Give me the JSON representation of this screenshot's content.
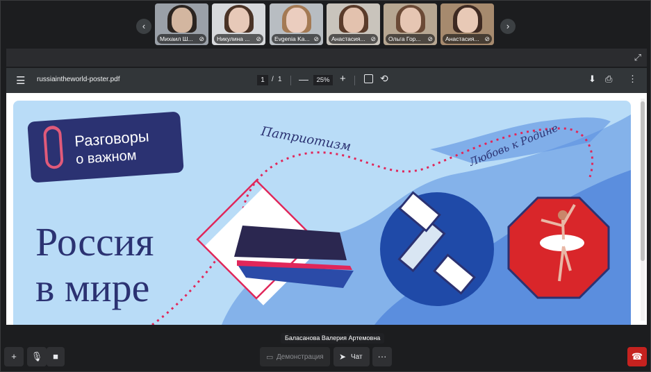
{
  "participants": [
    {
      "name": "Михаил Ш...",
      "skin": "#d3b6a0",
      "hair": "#2b2420",
      "bg": "#9aa0a8"
    },
    {
      "name": "Никулина ...",
      "skin": "#e7c9b8",
      "hair": "#4a3326",
      "bg": "#d7d9dc"
    },
    {
      "name": "Evgenia Ka...",
      "skin": "#ebcdbf",
      "hair": "#a47a54",
      "bg": "#b8bdc2"
    },
    {
      "name": "Анастасия...",
      "skin": "#e3c2ae",
      "hair": "#5a3b2a",
      "bg": "#c9c4bc"
    },
    {
      "name": "Ольга Гор...",
      "skin": "#e6c6b3",
      "hair": "#6b4a36",
      "bg": "#b7a792"
    },
    {
      "name": "Анастасия...",
      "skin": "#e8c9b6",
      "hair": "#3e2a22",
      "bg": "#a68a6e"
    }
  ],
  "strip_nav": {
    "prev": "‹",
    "next": "›"
  },
  "viewer": {
    "filename": "russiaintheworld-poster.pdf",
    "page_current": "1",
    "page_sep": "/",
    "page_total": "1",
    "zoom": "25%",
    "zoom_out": "—",
    "zoom_in": "+"
  },
  "poster": {
    "badge_line1": "Разговоры",
    "badge_line2": "о важном",
    "title_line1": "Россия",
    "title_line2": "в мире",
    "script1": "Патриотизм",
    "script2": "Любовь к Родине",
    "colors": {
      "bg": "#b9dcf7",
      "navy": "#2b3272",
      "red": "#d9262a",
      "pink": "#e0275a",
      "blue": "#1f4aa8"
    }
  },
  "speaker_caption": "Баласанова Валерия Артемовна",
  "controls": {
    "demo_label": "Демонстрация",
    "chat_label": "Чат"
  },
  "icons": [
    "add-participant-icon",
    "mic-off-icon",
    "camera-icon",
    "screen-share-icon",
    "send-icon",
    "more-icon",
    "hang-up-icon",
    "expand-icon",
    "menu-icon",
    "download-icon",
    "print-icon",
    "rotate-icon",
    "fit-page-icon"
  ]
}
